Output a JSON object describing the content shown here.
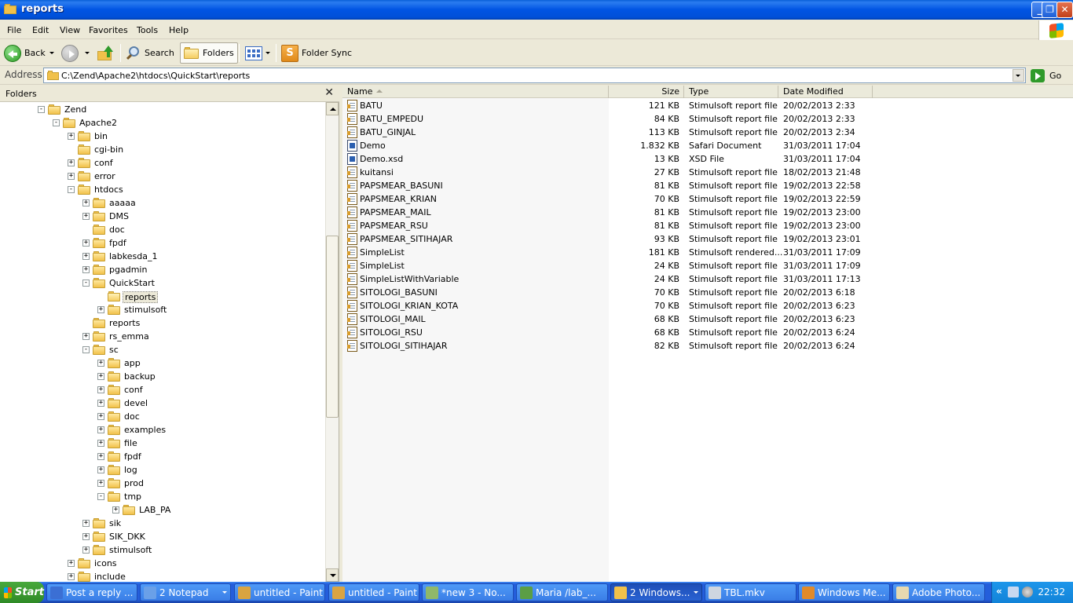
{
  "window": {
    "title": "reports",
    "buttons": {
      "minimize": "_",
      "maximize": "❐",
      "close": "✕"
    }
  },
  "menu": [
    "File",
    "Edit",
    "View",
    "Favorites",
    "Tools",
    "Help"
  ],
  "toolbar": {
    "back": "Back",
    "search": "Search",
    "folders": "Folders",
    "folder_sync": "Folder Sync"
  },
  "address": {
    "label": "Address",
    "value": "C:\\Zend\\Apache2\\htdocs\\QuickStart\\reports",
    "go": "Go"
  },
  "folders_pane": {
    "title": "Folders",
    "close": "✕",
    "tree": [
      {
        "label": "Zend",
        "level": 0,
        "toggle": "-"
      },
      {
        "label": "Apache2",
        "level": 1,
        "toggle": "-"
      },
      {
        "label": "bin",
        "level": 2,
        "toggle": "+"
      },
      {
        "label": "cgi-bin",
        "level": 2,
        "toggle": ""
      },
      {
        "label": "conf",
        "level": 2,
        "toggle": "+"
      },
      {
        "label": "error",
        "level": 2,
        "toggle": "+"
      },
      {
        "label": "htdocs",
        "level": 2,
        "toggle": "-"
      },
      {
        "label": "aaaaa",
        "level": 3,
        "toggle": "+"
      },
      {
        "label": "DMS",
        "level": 3,
        "toggle": "+"
      },
      {
        "label": "doc",
        "level": 3,
        "toggle": ""
      },
      {
        "label": "fpdf",
        "level": 3,
        "toggle": "+"
      },
      {
        "label": "labkesda_1",
        "level": 3,
        "toggle": "+"
      },
      {
        "label": "pgadmin",
        "level": 3,
        "toggle": "+"
      },
      {
        "label": "QuickStart",
        "level": 3,
        "toggle": "-"
      },
      {
        "label": "reports",
        "level": 4,
        "toggle": "",
        "selected": true
      },
      {
        "label": "stimulsoft",
        "level": 4,
        "toggle": "+"
      },
      {
        "label": "reports",
        "level": 3,
        "toggle": ""
      },
      {
        "label": "rs_emma",
        "level": 3,
        "toggle": "+"
      },
      {
        "label": "sc",
        "level": 3,
        "toggle": "-"
      },
      {
        "label": "app",
        "level": 4,
        "toggle": "+"
      },
      {
        "label": "backup",
        "level": 4,
        "toggle": "+"
      },
      {
        "label": "conf",
        "level": 4,
        "toggle": "+"
      },
      {
        "label": "devel",
        "level": 4,
        "toggle": "+"
      },
      {
        "label": "doc",
        "level": 4,
        "toggle": "+"
      },
      {
        "label": "examples",
        "level": 4,
        "toggle": "+"
      },
      {
        "label": "file",
        "level": 4,
        "toggle": "+"
      },
      {
        "label": "fpdf",
        "level": 4,
        "toggle": "+"
      },
      {
        "label": "log",
        "level": 4,
        "toggle": "+"
      },
      {
        "label": "prod",
        "level": 4,
        "toggle": "+"
      },
      {
        "label": "tmp",
        "level": 4,
        "toggle": "-"
      },
      {
        "label": "LAB_PA",
        "level": 5,
        "toggle": "+"
      },
      {
        "label": "sik",
        "level": 3,
        "toggle": "+"
      },
      {
        "label": "SIK_DKK",
        "level": 3,
        "toggle": "+"
      },
      {
        "label": "stimulsoft",
        "level": 3,
        "toggle": "+"
      },
      {
        "label": "icons",
        "level": 2,
        "toggle": "+"
      },
      {
        "label": "include",
        "level": 2,
        "toggle": "+"
      }
    ]
  },
  "columns": {
    "name": "Name",
    "size": "Size",
    "type": "Type",
    "date": "Date Modified"
  },
  "files": [
    {
      "name": "BATU",
      "size": "121 KB",
      "type": "Stimulsoft report file",
      "date": "20/02/2013 2:33",
      "icon": "report-file-icon"
    },
    {
      "name": "BATU_EMPEDU",
      "size": "84 KB",
      "type": "Stimulsoft report file",
      "date": "20/02/2013 2:33",
      "icon": "report-file-icon"
    },
    {
      "name": "BATU_GINJAL",
      "size": "113 KB",
      "type": "Stimulsoft report file",
      "date": "20/02/2013 2:34",
      "icon": "report-file-icon"
    },
    {
      "name": "Demo",
      "size": "1.832 KB",
      "type": "Safari Document",
      "date": "31/03/2011 17:04",
      "icon": "safari-document-icon"
    },
    {
      "name": "Demo.xsd",
      "size": "13 KB",
      "type": "XSD File",
      "date": "31/03/2011 17:04",
      "icon": "xsd-file-icon"
    },
    {
      "name": "kuitansi",
      "size": "27 KB",
      "type": "Stimulsoft report file",
      "date": "18/02/2013 21:48",
      "icon": "report-file-icon"
    },
    {
      "name": "PAPSMEAR_BASUNI",
      "size": "81 KB",
      "type": "Stimulsoft report file",
      "date": "19/02/2013 22:58",
      "icon": "report-file-icon"
    },
    {
      "name": "PAPSMEAR_KRIAN",
      "size": "70 KB",
      "type": "Stimulsoft report file",
      "date": "19/02/2013 22:59",
      "icon": "report-file-icon"
    },
    {
      "name": "PAPSMEAR_MAIL",
      "size": "81 KB",
      "type": "Stimulsoft report file",
      "date": "19/02/2013 23:00",
      "icon": "report-file-icon"
    },
    {
      "name": "PAPSMEAR_RSU",
      "size": "81 KB",
      "type": "Stimulsoft report file",
      "date": "19/02/2013 23:00",
      "icon": "report-file-icon"
    },
    {
      "name": "PAPSMEAR_SITIHAJAR",
      "size": "93 KB",
      "type": "Stimulsoft report file",
      "date": "19/02/2013 23:01",
      "icon": "report-file-icon"
    },
    {
      "name": "SimpleList",
      "size": "181 KB",
      "type": "Stimulsoft rendered...",
      "date": "31/03/2011 17:09",
      "icon": "report-file-icon"
    },
    {
      "name": "SimpleList",
      "size": "24 KB",
      "type": "Stimulsoft report file",
      "date": "31/03/2011 17:09",
      "icon": "report-file-icon"
    },
    {
      "name": "SimpleListWithVariable",
      "size": "24 KB",
      "type": "Stimulsoft report file",
      "date": "31/03/2011 17:13",
      "icon": "report-file-icon"
    },
    {
      "name": "SITOLOGI_BASUNI",
      "size": "70 KB",
      "type": "Stimulsoft report file",
      "date": "20/02/2013 6:18",
      "icon": "report-file-icon"
    },
    {
      "name": "SITOLOGI_KRIAN_KOTA",
      "size": "70 KB",
      "type": "Stimulsoft report file",
      "date": "20/02/2013 6:23",
      "icon": "report-file-icon"
    },
    {
      "name": "SITOLOGI_MAIL",
      "size": "68 KB",
      "type": "Stimulsoft report file",
      "date": "20/02/2013 6:23",
      "icon": "report-file-icon"
    },
    {
      "name": "SITOLOGI_RSU",
      "size": "68 KB",
      "type": "Stimulsoft report file",
      "date": "20/02/2013 6:24",
      "icon": "report-file-icon"
    },
    {
      "name": "SITOLOGI_SITIHAJAR",
      "size": "82 KB",
      "type": "Stimulsoft report file",
      "date": "20/02/2013 6:24",
      "icon": "report-file-icon"
    }
  ],
  "taskbar": {
    "start": "Start",
    "tasks": [
      {
        "label": "Post a reply ...",
        "color": "#3b6fd4",
        "dropdown": false
      },
      {
        "label": "2 Notepad",
        "color": "#6aa0e8",
        "dropdown": true
      },
      {
        "label": "untitled - Paint",
        "color": "#d9a441",
        "dropdown": false
      },
      {
        "label": "untitled - Paint",
        "color": "#d9a441",
        "dropdown": false
      },
      {
        "label": "*new  3 - No...",
        "color": "#8fb86a",
        "dropdown": false
      },
      {
        "label": "Maria /lab_...",
        "color": "#5b9e45",
        "dropdown": false
      },
      {
        "label": "2 Windows...",
        "color": "#f1c14a",
        "dropdown": true,
        "active": true
      },
      {
        "label": "TBL.mkv",
        "color": "#cfd6e0",
        "dropdown": false
      },
      {
        "label": "Windows Me...",
        "color": "#e08a2a",
        "dropdown": false
      },
      {
        "label": "Adobe Photo...",
        "color": "#e7d9b0",
        "dropdown": false
      }
    ],
    "clock": "22:32",
    "tray_chevron": "«"
  },
  "colors": {
    "titlebar": "#0054e3",
    "taskbar": "#245edb",
    "start": "#3c9a31",
    "chrome": "#ece9d8"
  }
}
